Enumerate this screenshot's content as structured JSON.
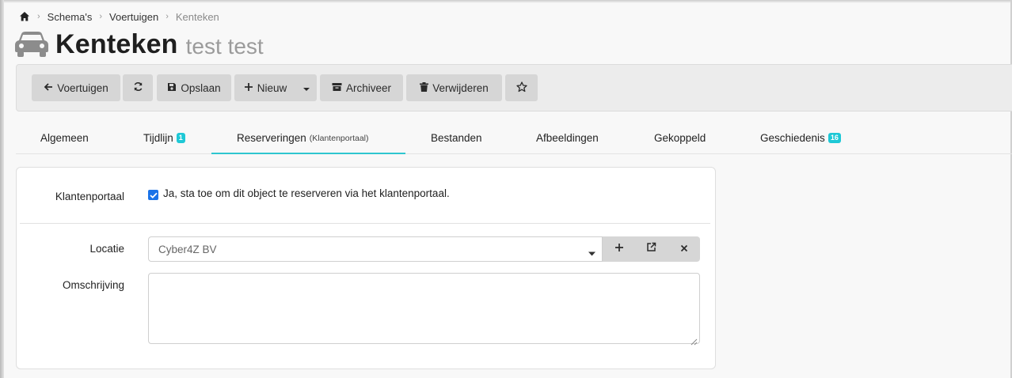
{
  "breadcrumb": {
    "items": [
      "Schema's",
      "Voertuigen"
    ],
    "current": "Kenteken"
  },
  "title": {
    "main": "Kenteken",
    "sub": "test test"
  },
  "toolbar": {
    "back_label": "Voertuigen",
    "save_label": "Opslaan",
    "new_label": "Nieuw",
    "archive_label": "Archiveer",
    "delete_label": "Verwijderen"
  },
  "tabs": [
    {
      "label": "Algemeen"
    },
    {
      "label": "Tijdlijn",
      "badge": "1"
    },
    {
      "label": "Reserveringen",
      "sub": "(Klantenportaal)",
      "active": true
    },
    {
      "label": "Bestanden"
    },
    {
      "label": "Afbeeldingen"
    },
    {
      "label": "Gekoppeld"
    },
    {
      "label": "Geschiedenis",
      "badge": "16"
    }
  ],
  "form": {
    "klantenportaal_label": "Klantenportaal",
    "klantenportaal_checked": true,
    "klantenportaal_text": "Ja, sta toe om dit object te reserveren via het klantenportaal.",
    "locatie_label": "Locatie",
    "locatie_value": "Cyber4Z BV",
    "omschrijving_label": "Omschrijving",
    "omschrijving_value": ""
  },
  "colors": {
    "accent": "#2fc6d0",
    "badge": "#1ec8d6",
    "checkbox": "#1a73e8",
    "button_bg": "#d6d6d6"
  },
  "icons": [
    "home-icon",
    "car-icon",
    "arrow-left-icon",
    "refresh-icon",
    "save-icon",
    "plus-icon",
    "caret-down-icon",
    "archive-icon",
    "trash-icon",
    "star-icon",
    "external-link-icon",
    "close-icon"
  ]
}
